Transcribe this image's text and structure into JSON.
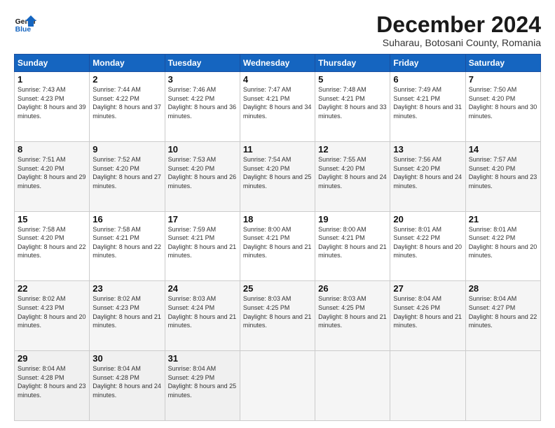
{
  "logo": {
    "line1": "General",
    "line2": "Blue"
  },
  "title": "December 2024",
  "subtitle": "Suharau, Botosani County, Romania",
  "headers": [
    "Sunday",
    "Monday",
    "Tuesday",
    "Wednesday",
    "Thursday",
    "Friday",
    "Saturday"
  ],
  "weeks": [
    [
      {
        "day": "1",
        "sunrise": "7:43 AM",
        "sunset": "4:23 PM",
        "daylight": "8 hours and 39 minutes."
      },
      {
        "day": "2",
        "sunrise": "7:44 AM",
        "sunset": "4:22 PM",
        "daylight": "8 hours and 37 minutes."
      },
      {
        "day": "3",
        "sunrise": "7:46 AM",
        "sunset": "4:22 PM",
        "daylight": "8 hours and 36 minutes."
      },
      {
        "day": "4",
        "sunrise": "7:47 AM",
        "sunset": "4:21 PM",
        "daylight": "8 hours and 34 minutes."
      },
      {
        "day": "5",
        "sunrise": "7:48 AM",
        "sunset": "4:21 PM",
        "daylight": "8 hours and 33 minutes."
      },
      {
        "day": "6",
        "sunrise": "7:49 AM",
        "sunset": "4:21 PM",
        "daylight": "8 hours and 31 minutes."
      },
      {
        "day": "7",
        "sunrise": "7:50 AM",
        "sunset": "4:20 PM",
        "daylight": "8 hours and 30 minutes."
      }
    ],
    [
      {
        "day": "8",
        "sunrise": "7:51 AM",
        "sunset": "4:20 PM",
        "daylight": "8 hours and 29 minutes."
      },
      {
        "day": "9",
        "sunrise": "7:52 AM",
        "sunset": "4:20 PM",
        "daylight": "8 hours and 27 minutes."
      },
      {
        "day": "10",
        "sunrise": "7:53 AM",
        "sunset": "4:20 PM",
        "daylight": "8 hours and 26 minutes."
      },
      {
        "day": "11",
        "sunrise": "7:54 AM",
        "sunset": "4:20 PM",
        "daylight": "8 hours and 25 minutes."
      },
      {
        "day": "12",
        "sunrise": "7:55 AM",
        "sunset": "4:20 PM",
        "daylight": "8 hours and 24 minutes."
      },
      {
        "day": "13",
        "sunrise": "7:56 AM",
        "sunset": "4:20 PM",
        "daylight": "8 hours and 24 minutes."
      },
      {
        "day": "14",
        "sunrise": "7:57 AM",
        "sunset": "4:20 PM",
        "daylight": "8 hours and 23 minutes."
      }
    ],
    [
      {
        "day": "15",
        "sunrise": "7:58 AM",
        "sunset": "4:20 PM",
        "daylight": "8 hours and 22 minutes."
      },
      {
        "day": "16",
        "sunrise": "7:58 AM",
        "sunset": "4:21 PM",
        "daylight": "8 hours and 22 minutes."
      },
      {
        "day": "17",
        "sunrise": "7:59 AM",
        "sunset": "4:21 PM",
        "daylight": "8 hours and 21 minutes."
      },
      {
        "day": "18",
        "sunrise": "8:00 AM",
        "sunset": "4:21 PM",
        "daylight": "8 hours and 21 minutes."
      },
      {
        "day": "19",
        "sunrise": "8:00 AM",
        "sunset": "4:21 PM",
        "daylight": "8 hours and 21 minutes."
      },
      {
        "day": "20",
        "sunrise": "8:01 AM",
        "sunset": "4:22 PM",
        "daylight": "8 hours and 20 minutes."
      },
      {
        "day": "21",
        "sunrise": "8:01 AM",
        "sunset": "4:22 PM",
        "daylight": "8 hours and 20 minutes."
      }
    ],
    [
      {
        "day": "22",
        "sunrise": "8:02 AM",
        "sunset": "4:23 PM",
        "daylight": "8 hours and 20 minutes."
      },
      {
        "day": "23",
        "sunrise": "8:02 AM",
        "sunset": "4:23 PM",
        "daylight": "8 hours and 21 minutes."
      },
      {
        "day": "24",
        "sunrise": "8:03 AM",
        "sunset": "4:24 PM",
        "daylight": "8 hours and 21 minutes."
      },
      {
        "day": "25",
        "sunrise": "8:03 AM",
        "sunset": "4:25 PM",
        "daylight": "8 hours and 21 minutes."
      },
      {
        "day": "26",
        "sunrise": "8:03 AM",
        "sunset": "4:25 PM",
        "daylight": "8 hours and 21 minutes."
      },
      {
        "day": "27",
        "sunrise": "8:04 AM",
        "sunset": "4:26 PM",
        "daylight": "8 hours and 21 minutes."
      },
      {
        "day": "28",
        "sunrise": "8:04 AM",
        "sunset": "4:27 PM",
        "daylight": "8 hours and 22 minutes."
      }
    ],
    [
      {
        "day": "29",
        "sunrise": "8:04 AM",
        "sunset": "4:28 PM",
        "daylight": "8 hours and 23 minutes."
      },
      {
        "day": "30",
        "sunrise": "8:04 AM",
        "sunset": "4:28 PM",
        "daylight": "8 hours and 24 minutes."
      },
      {
        "day": "31",
        "sunrise": "8:04 AM",
        "sunset": "4:29 PM",
        "daylight": "8 hours and 25 minutes."
      },
      null,
      null,
      null,
      null
    ]
  ],
  "labels": {
    "sunrise": "Sunrise:",
    "sunset": "Sunset:",
    "daylight": "Daylight:"
  }
}
